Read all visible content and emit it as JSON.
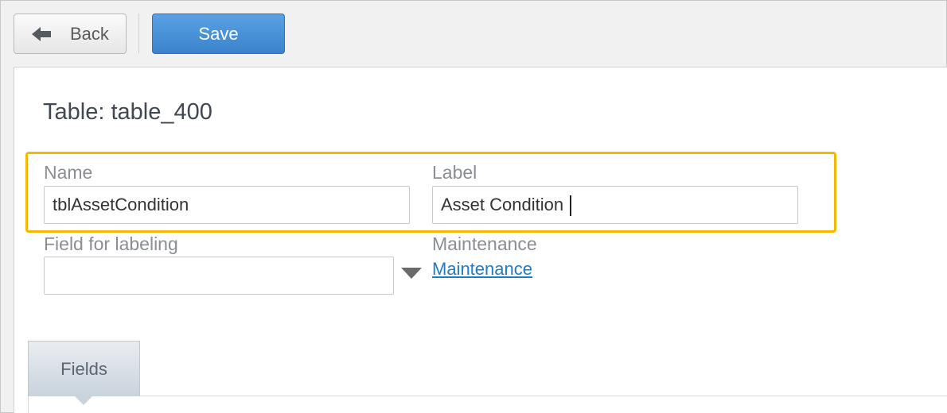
{
  "toolbar": {
    "back_label": "Back",
    "save_label": "Save"
  },
  "page": {
    "title": "Table: table_400"
  },
  "form": {
    "name": {
      "label": "Name",
      "value": "tblAssetCondition"
    },
    "label": {
      "label": "Label",
      "value": "Asset Condition"
    },
    "field_for_labeling": {
      "label": "Field for labeling",
      "value": ""
    },
    "maintenance": {
      "label": "Maintenance",
      "link_text": "Maintenance"
    }
  },
  "tabs": [
    {
      "label": "Fields",
      "active": true
    }
  ],
  "colors": {
    "accent": "#3a83cc",
    "highlight": "#f5b800",
    "link": "#1e7bc6"
  }
}
